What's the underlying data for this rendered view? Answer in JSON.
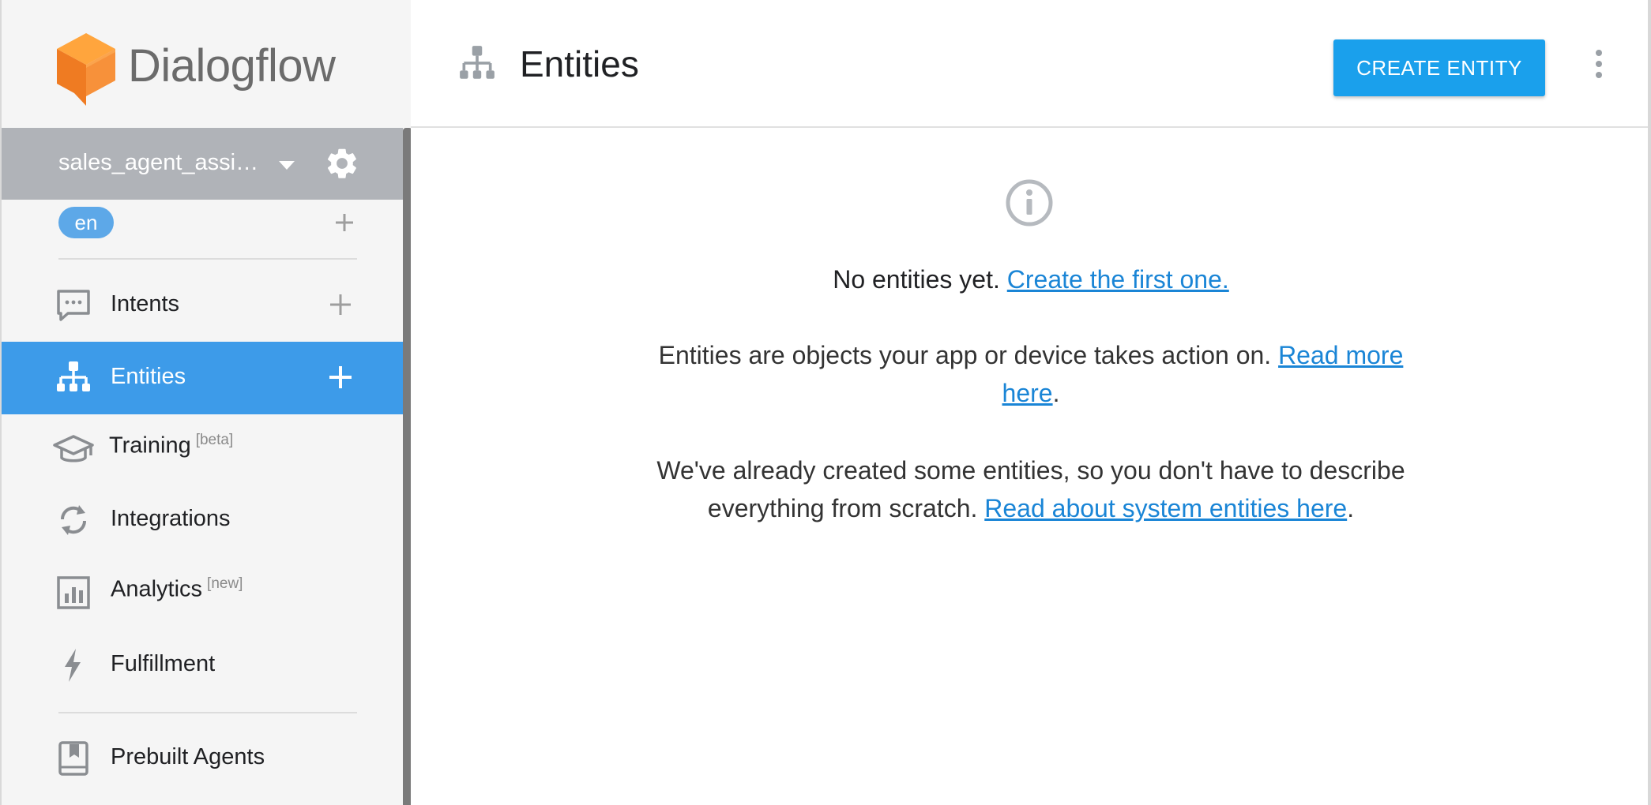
{
  "app": {
    "brand_name": "Dialogflow"
  },
  "sidebar": {
    "agent_name": "sales_agent_assist...",
    "language_badge": "en",
    "items": [
      {
        "label": "Intents",
        "sup": "",
        "icon": "chat-bubble-icon",
        "active": false,
        "has_add": true
      },
      {
        "label": "Entities",
        "sup": "",
        "icon": "hierarchy-icon",
        "active": true,
        "has_add": true
      },
      {
        "label": "Training",
        "sup": "[beta]",
        "icon": "graduation-cap-icon",
        "active": false,
        "has_add": false
      },
      {
        "label": "Integrations",
        "sup": "",
        "icon": "sync-icon",
        "active": false,
        "has_add": false
      },
      {
        "label": "Analytics",
        "sup": "[new]",
        "icon": "bar-chart-icon",
        "active": false,
        "has_add": false
      },
      {
        "label": "Fulfillment",
        "sup": "",
        "icon": "lightning-bolt-icon",
        "active": false,
        "has_add": false
      },
      {
        "label": "Prebuilt Agents",
        "sup": "",
        "icon": "book-icon",
        "active": false,
        "has_add": false
      }
    ]
  },
  "header": {
    "title": "Entities",
    "create_button_label": "CREATE ENTITY"
  },
  "empty_state": {
    "message": "No entities yet.",
    "message_link": "Create the first one.",
    "p1_text": "Entities are objects your app or device takes action on.",
    "p1_link": "Read more here",
    "p1_end": ".",
    "p2_text": "We've already created some entities, so you don't have to describe everything from scratch.",
    "p2_link": "Read about system entities here",
    "p2_end": "."
  },
  "colors": {
    "accent": "#1aa0ec",
    "active_nav": "#3d9be9",
    "logo_orange": "#f08326",
    "link": "#1a85d6",
    "agent_bar": "#b0b3b8"
  }
}
